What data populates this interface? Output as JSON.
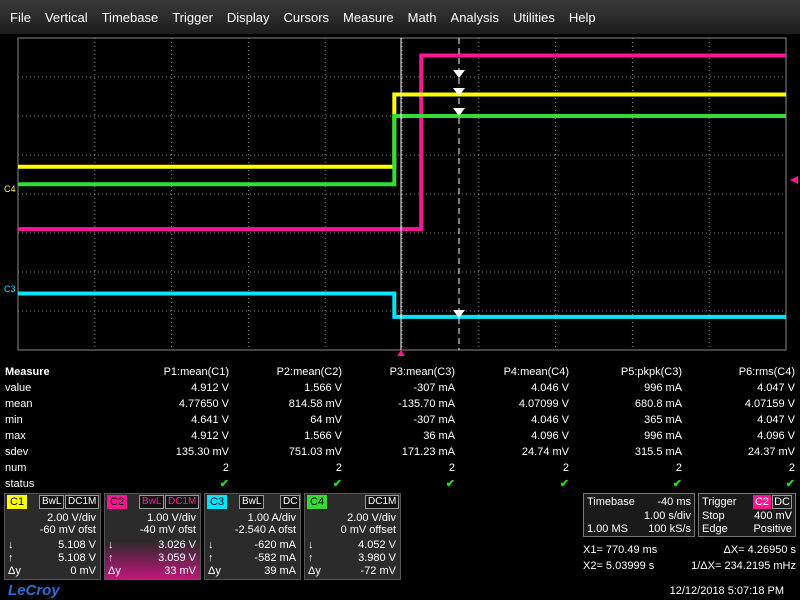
{
  "menu": [
    "File",
    "Vertical",
    "Timebase",
    "Trigger",
    "Display",
    "Cursors",
    "Measure",
    "Math",
    "Analysis",
    "Utilities",
    "Help"
  ],
  "colors": {
    "c1": "#ffff00",
    "c2": "#ff1493",
    "c3": "#00e5ff",
    "c4": "#33dd33",
    "grid": "#8a8a8a"
  },
  "traces": {
    "c1": {
      "pre": 3.3,
      "post": 1.45,
      "split": 0.49
    },
    "c2": {
      "pre": 4.9,
      "post": 0.45,
      "split": 0.525
    },
    "c3": {
      "pre": 6.55,
      "post": 7.15,
      "split": 0.49
    },
    "c4": {
      "pre": 3.75,
      "post": 2.0,
      "split": 0.49
    }
  },
  "trace_markers": {
    "c4": "C4",
    "c3": "C3"
  },
  "measure": {
    "title": "Measure",
    "columns": [
      "P1:mean(C1)",
      "P2:mean(C2)",
      "P3:mean(C3)",
      "P4:mean(C4)",
      "P5:pkpk(C3)",
      "P6:rms(C4)"
    ],
    "rows": [
      {
        "label": "value",
        "cells": [
          "4.912 V",
          "1.566 V",
          "-307 mA",
          "4.046 V",
          "996 mA",
          "4.047 V"
        ]
      },
      {
        "label": "mean",
        "cells": [
          "4.77650 V",
          "814.58 mV",
          "-135.70 mA",
          "4.07099 V",
          "680.8 mA",
          "4.07159 V"
        ]
      },
      {
        "label": "min",
        "cells": [
          "4.641 V",
          "64 mV",
          "-307 mA",
          "4.046 V",
          "365 mA",
          "4.047 V"
        ]
      },
      {
        "label": "max",
        "cells": [
          "4.912 V",
          "1.566 V",
          "36 mA",
          "4.096 V",
          "996 mA",
          "4.096 V"
        ]
      },
      {
        "label": "sdev",
        "cells": [
          "135.30 mV",
          "751.03 mV",
          "171.23 mA",
          "24.74 mV",
          "315.5 mA",
          "24.37 mV"
        ]
      },
      {
        "label": "num",
        "cells": [
          "2",
          "2",
          "2",
          "2",
          "2",
          "2"
        ]
      },
      {
        "label": "status",
        "cells": [
          "✔",
          "✔",
          "✔",
          "✔",
          "✔",
          "✔"
        ]
      }
    ]
  },
  "channels": [
    {
      "tag": "C1",
      "bw": [
        "BwL",
        "DC1M"
      ],
      "scale": "2.00 V/div",
      "offset": "-60 mV ofst",
      "v1": "5.108 V",
      "v2": "5.108 V",
      "dy": "0 mV"
    },
    {
      "tag": "C2",
      "bw": [
        "BwL",
        "DC1M"
      ],
      "scale": "1.00 V/div",
      "offset": "-40 mV ofst",
      "v1": "3.026 V",
      "v2": "3.059 V",
      "dy": "33 mV"
    },
    {
      "tag": "C3",
      "bw": [
        "BwL",
        "DC"
      ],
      "scale": "1.00 A/div",
      "offset": "-2.540 A ofst",
      "v1": "-620 mA",
      "v2": "-582 mA",
      "dy": "39 mA"
    },
    {
      "tag": "C4",
      "bw": [
        "",
        "DC1M"
      ],
      "scale": "2.00 V/div",
      "offset": "0 mV offset",
      "v1": "4.052 V",
      "v2": "3.980 V",
      "dy": "-72 mV"
    }
  ],
  "channel_row_labels": {
    "down": "↓",
    "up": "↑",
    "dy": "Δy"
  },
  "timebase": {
    "label": "Timebase",
    "delay": "-40 ms",
    "div": "1.00 s/div",
    "samples": "1.00 MS",
    "rate": "100 kS/s"
  },
  "trigger": {
    "label": "Trigger",
    "chan": "C2",
    "coupling": "DC",
    "mode": "Stop",
    "level": "400 mV",
    "type": "Edge",
    "slope": "Positive"
  },
  "cursors": {
    "x1": "X1= 770.49 ms",
    "dx": "ΔX= 4.26950 s",
    "x2": "X2= 5.03999 s",
    "inv": "1/ΔX= 234.2195 mHz"
  },
  "footer": {
    "logo": "LeCroy",
    "datetime": "12/12/2018 5:07:18 PM"
  }
}
